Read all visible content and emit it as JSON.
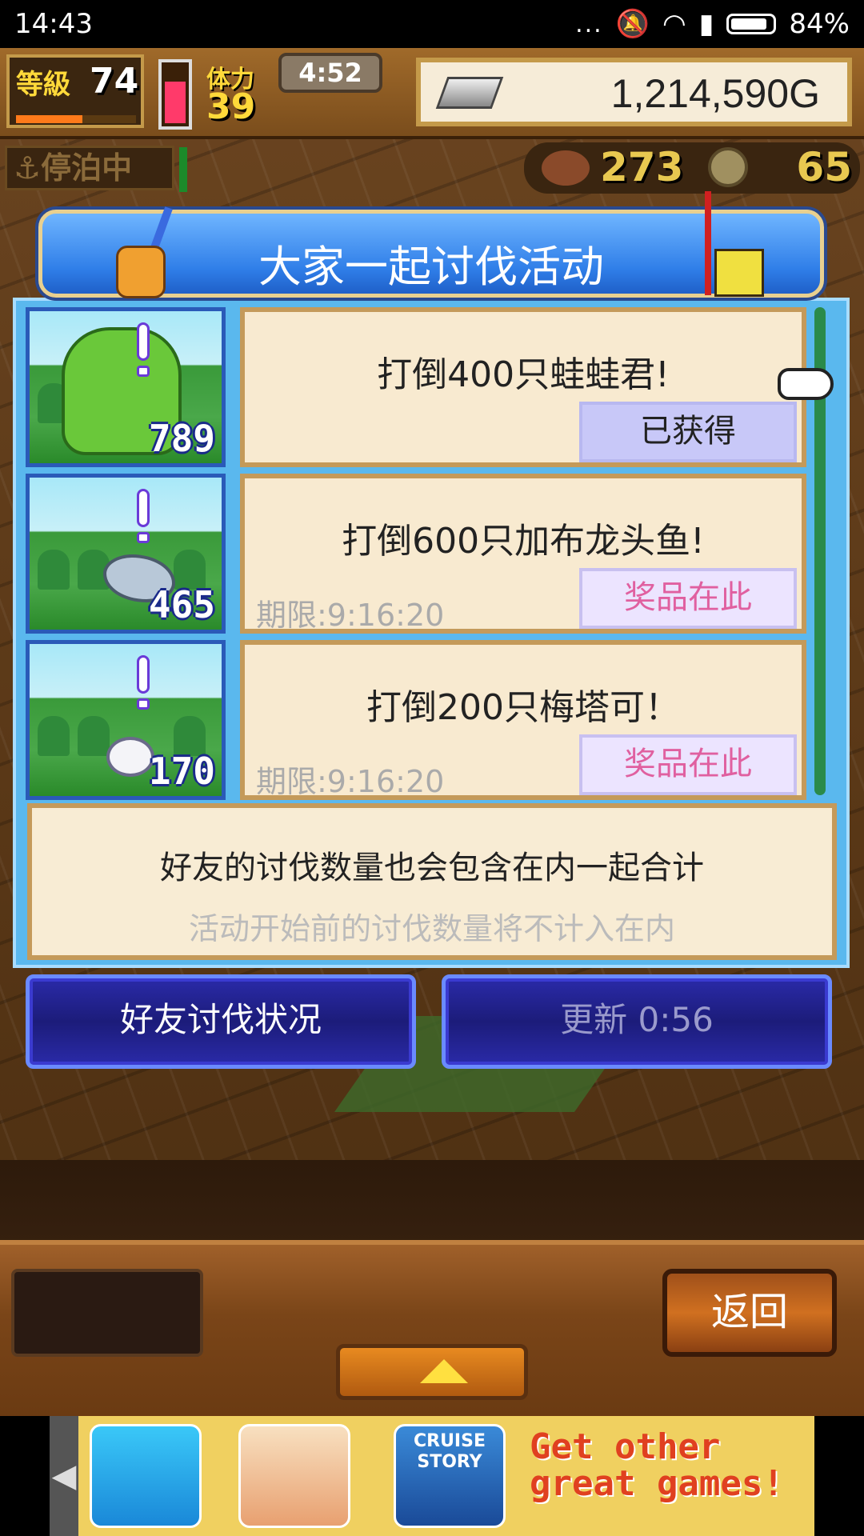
{
  "status_bar": {
    "time": "14:43",
    "signal_dots": "...",
    "battery": "84%"
  },
  "hud": {
    "level_label": "等級",
    "level": "74",
    "level_progress": 0.55,
    "stamina_label": "体力",
    "stamina": "39",
    "stamina_fill": 0.65,
    "timer": "4:52",
    "gold": "1,214,590G",
    "port_status": "停泊中",
    "food": "273",
    "medals": "65"
  },
  "event": {
    "title": "大家一起讨伐活动",
    "items": [
      {
        "monster": "frog",
        "count": "789",
        "title": "打倒400只蛙蛙君!",
        "deadline": "",
        "button": "已获得",
        "claimed": true
      },
      {
        "monster": "fish",
        "count": "465",
        "title": "打倒600只加布龙头鱼!",
        "deadline": "期限:9:16:20",
        "button": "奖品在此",
        "claimed": false
      },
      {
        "monster": "rabbit",
        "count": "170",
        "title": "打倒200只梅塔可！",
        "deadline": "期限:9:16:20",
        "button": "奖品在此",
        "claimed": false
      }
    ],
    "note_main": "好友的讨伐数量也会包含在内一起合计",
    "note_sub": "活动开始前的讨伐数量将不计入在内",
    "friends_button": "好友讨伐状况",
    "update_button": "更新 0:56"
  },
  "bottom": {
    "back_button": "返回"
  },
  "ad": {
    "tile3_label": "CRUISE STORY",
    "text": "Get other great games!"
  },
  "colors": {
    "panel_blue": "#5ab8ee",
    "card_bg": "#f8ead0",
    "prize_pink": "#e060a0",
    "button_navy": "#1c1c7a"
  }
}
